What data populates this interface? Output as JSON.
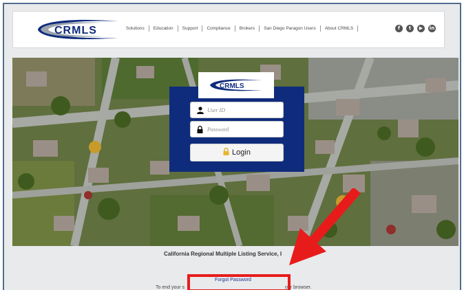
{
  "brand": {
    "logo_text": "CRMLS",
    "colors": {
      "navy": "#0f2c7c",
      "annotation_red": "#e81b1b",
      "link": "#1a2f8a"
    }
  },
  "header": {
    "nav": [
      "Solutions",
      "Education",
      "Support",
      "Compliance",
      "Brokers",
      "San Diego Paragon Users",
      "About CRMLS"
    ],
    "social_icons": [
      "facebook-icon",
      "twitter-icon",
      "youtube-icon",
      "linkedin-icon"
    ]
  },
  "login": {
    "user_id_placeholder": "User ID",
    "password_placeholder": "Password",
    "button_label": "Login",
    "icons": [
      "user-icon",
      "lock-icon",
      "padlock-icon"
    ]
  },
  "footer": {
    "tagline": "California Regional Multiple Listing Service, I",
    "forgot_link": "Forgot Password",
    "end_text_left": "To end your s",
    "end_text_right": "our browser."
  }
}
